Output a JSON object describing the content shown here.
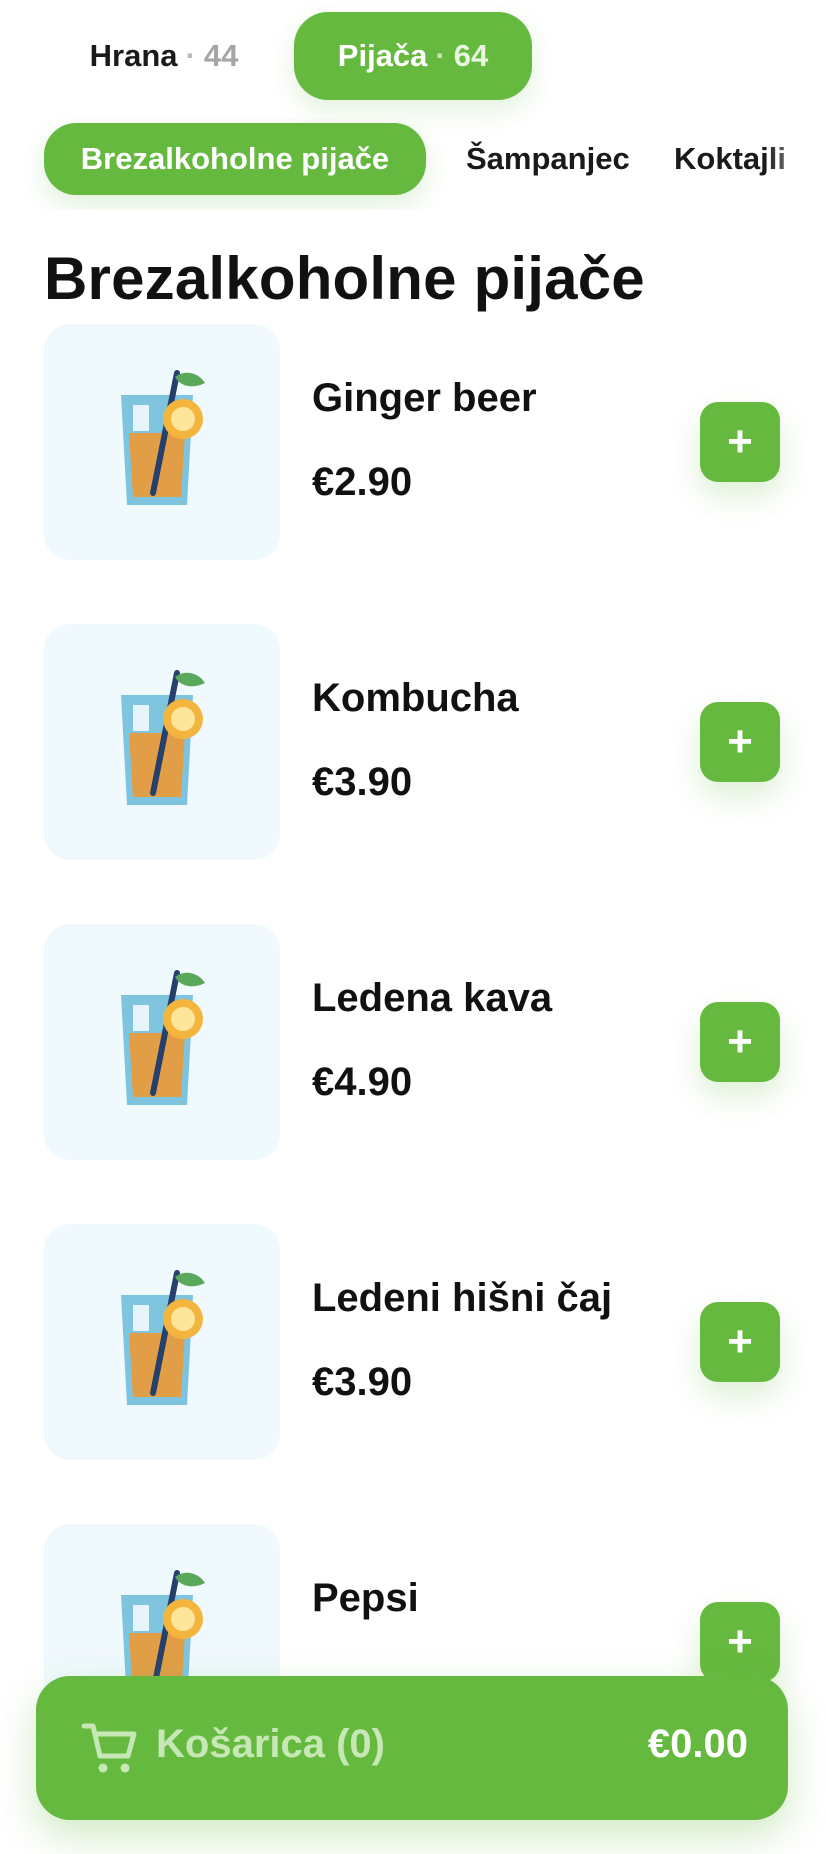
{
  "main_tabs": [
    {
      "label": "Hrana",
      "count": "44",
      "active": false
    },
    {
      "label": "Pijača",
      "count": "64",
      "active": true
    }
  ],
  "categories": [
    {
      "label": "Brezalkoholne pijače",
      "active": true
    },
    {
      "label": "Šampanjec",
      "active": false
    },
    {
      "label": "Koktajli",
      "active": false
    }
  ],
  "section_title": "Brezalkoholne pijače",
  "items": [
    {
      "name": "Ginger beer",
      "price": "€2.90",
      "icon": "drink-icon"
    },
    {
      "name": "Kombucha",
      "price": "€3.90",
      "icon": "drink-icon"
    },
    {
      "name": "Ledena kava",
      "price": "€4.90",
      "icon": "drink-icon"
    },
    {
      "name": "Ledeni hišni čaj",
      "price": "€3.90",
      "icon": "drink-icon"
    },
    {
      "name": "Pepsi",
      "price": "",
      "icon": "drink-icon"
    }
  ],
  "add_symbol": "+",
  "cart": {
    "label": "Košarica (0)",
    "total": "€0.00",
    "icon": "cart-icon"
  },
  "colors": {
    "accent": "#66b93f",
    "thumb_bg": "#f0f9fe",
    "text": "#111111",
    "muted": "#a5a5a5"
  }
}
